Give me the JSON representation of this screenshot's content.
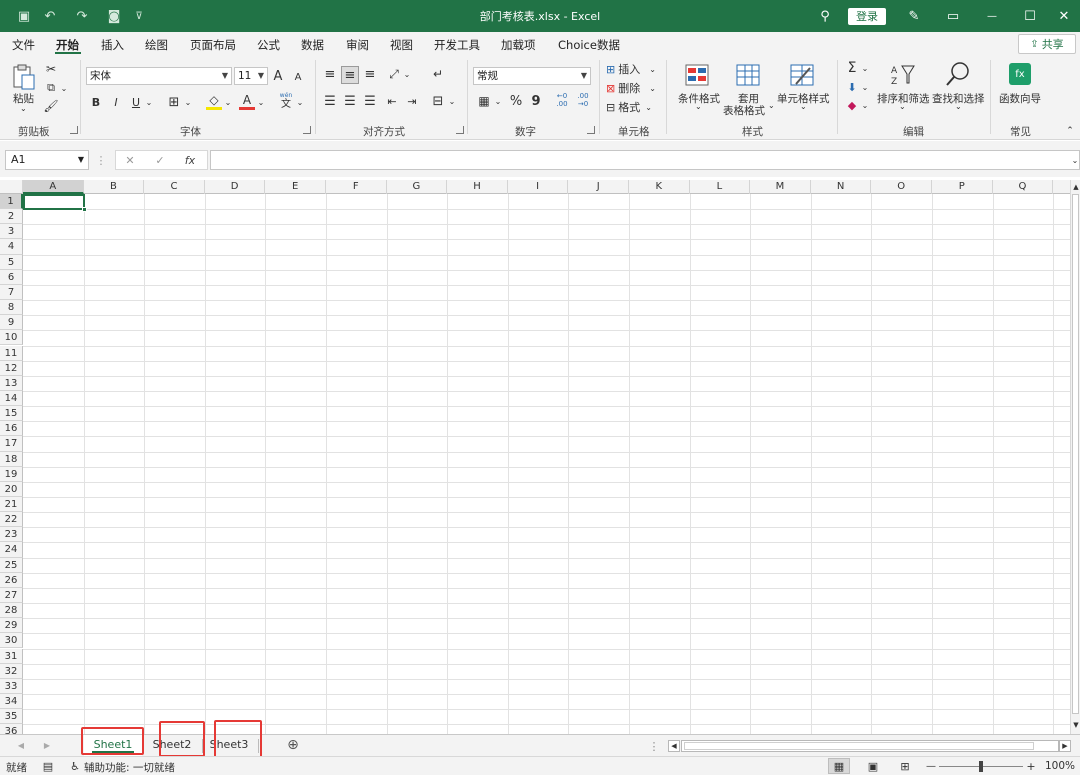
{
  "titlebar": {
    "title": "部门考核表.xlsx  -  Excel",
    "login": "登录",
    "quick_access": {
      "save": "▣",
      "undo": "↶",
      "redo": "↷",
      "camera": "◙",
      "customize": "⊽"
    },
    "search": "⚲",
    "pen": "✎",
    "ribbon_display": "▭",
    "minimize": "—",
    "maximize": "☐",
    "close": "✕"
  },
  "menu": {
    "items": [
      "文件",
      "开始",
      "插入",
      "绘图",
      "页面布局",
      "公式",
      "数据",
      "审阅",
      "视图",
      "开发工具",
      "加载项",
      "Choice数据"
    ],
    "active": "开始",
    "share": "共享"
  },
  "ribbon": {
    "clipboard": {
      "label": "剪贴板",
      "paste": "粘贴"
    },
    "font": {
      "label": "字体",
      "name": "宋体",
      "size": "11",
      "bold": "B",
      "italic": "I",
      "underline": "U",
      "grow": "A",
      "shrink": "A",
      "wen": "wén",
      "wen_char": "文"
    },
    "alignment": {
      "label": "对齐方式"
    },
    "number": {
      "label": "数字",
      "format": "常规",
      "percent": "%",
      "comma": "9",
      "inc_dec": "←0 .00",
      "dec_dec": ".00 →0"
    },
    "cells": {
      "label": "单元格",
      "insert": "插入",
      "delete": "删除",
      "format": "格式"
    },
    "styles": {
      "label": "样式",
      "conditional": "条件格式",
      "table_line1": "套用",
      "table_line2": "表格格式",
      "cell_styles": "单元格样式"
    },
    "editing": {
      "label": "编辑",
      "sort_filter": "排序和筛选",
      "find_select": "查找和选择",
      "sigma": "Σ"
    },
    "common": {
      "label": "常见",
      "function_wizard": "函数向导",
      "fx": "fx"
    }
  },
  "formula_bar": {
    "name_box": "A1",
    "cancel": "✕",
    "enter": "✓",
    "fx": "fx",
    "value": ""
  },
  "grid": {
    "columns": [
      "A",
      "B",
      "C",
      "D",
      "E",
      "F",
      "G",
      "H",
      "I",
      "J",
      "K",
      "L",
      "M",
      "N",
      "O",
      "P",
      "Q"
    ],
    "rows": [
      "1",
      "2",
      "3",
      "4",
      "5",
      "6",
      "7",
      "8",
      "9",
      "10",
      "11",
      "12",
      "13",
      "14",
      "15",
      "16",
      "17",
      "18",
      "19",
      "20",
      "21",
      "22",
      "23",
      "24",
      "25",
      "26",
      "27",
      "28",
      "29",
      "30",
      "31",
      "32",
      "33",
      "34",
      "35",
      "36"
    ],
    "selected_cell": "A1"
  },
  "sheets": {
    "tabs": [
      "Sheet1",
      "Sheet2",
      "Sheet3"
    ],
    "active": "Sheet1",
    "add": "⊕"
  },
  "status": {
    "ready": "就绪",
    "accessibility": "辅助功能: 一切就绪",
    "zoom": "100%",
    "zoom_minus": "—",
    "zoom_plus": "+"
  },
  "colors": {
    "accent": "#217346",
    "highlight_box": "#e53935"
  }
}
